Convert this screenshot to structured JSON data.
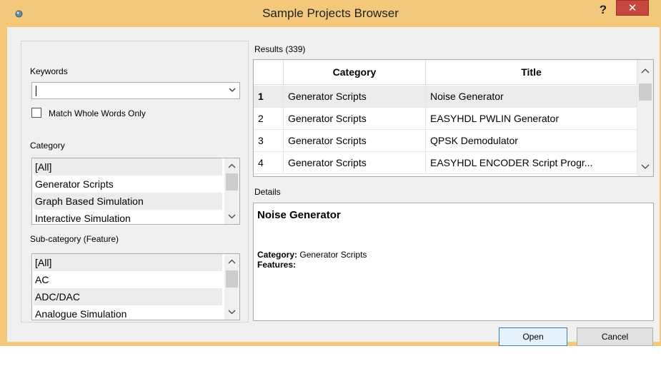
{
  "window": {
    "title": "Sample Projects Browser",
    "help_label": "?",
    "close_label": "✕",
    "accent_color": "#f4c87a",
    "close_color": "#c7463d"
  },
  "filters": {
    "keywords_label": "Keywords",
    "keywords_value": "",
    "match_whole_words_label": "Match Whole Words Only",
    "match_whole_words_checked": false,
    "category_label": "Category",
    "category_items": [
      "[All]",
      "Generator Scripts",
      "Graph Based Simulation",
      "Interactive Simulation"
    ],
    "subcategory_label": "Sub-category (Feature)",
    "subcategory_items": [
      "[All]",
      "AC",
      "ADC/DAC",
      "Analogue Simulation"
    ]
  },
  "results": {
    "label": "Results (339)",
    "columns": [
      "Category",
      "Title"
    ],
    "rows": [
      {
        "num": "1",
        "category": "Generator Scripts",
        "title": "Noise Generator"
      },
      {
        "num": "2",
        "category": "Generator Scripts",
        "title": "EASYHDL PWLIN Generator"
      },
      {
        "num": "3",
        "category": "Generator Scripts",
        "title": "QPSK Demodulator"
      },
      {
        "num": "4",
        "category": "Generator Scripts",
        "title": "EASYHDL ENCODER Script Progr..."
      }
    ]
  },
  "details": {
    "label": "Details",
    "title": "Noise Generator",
    "category_key": "Category",
    "category_value": "Generator Scripts",
    "features_key": "Features",
    "features_value": ""
  },
  "buttons": {
    "open_label": "Open",
    "cancel_label": "Cancel"
  }
}
